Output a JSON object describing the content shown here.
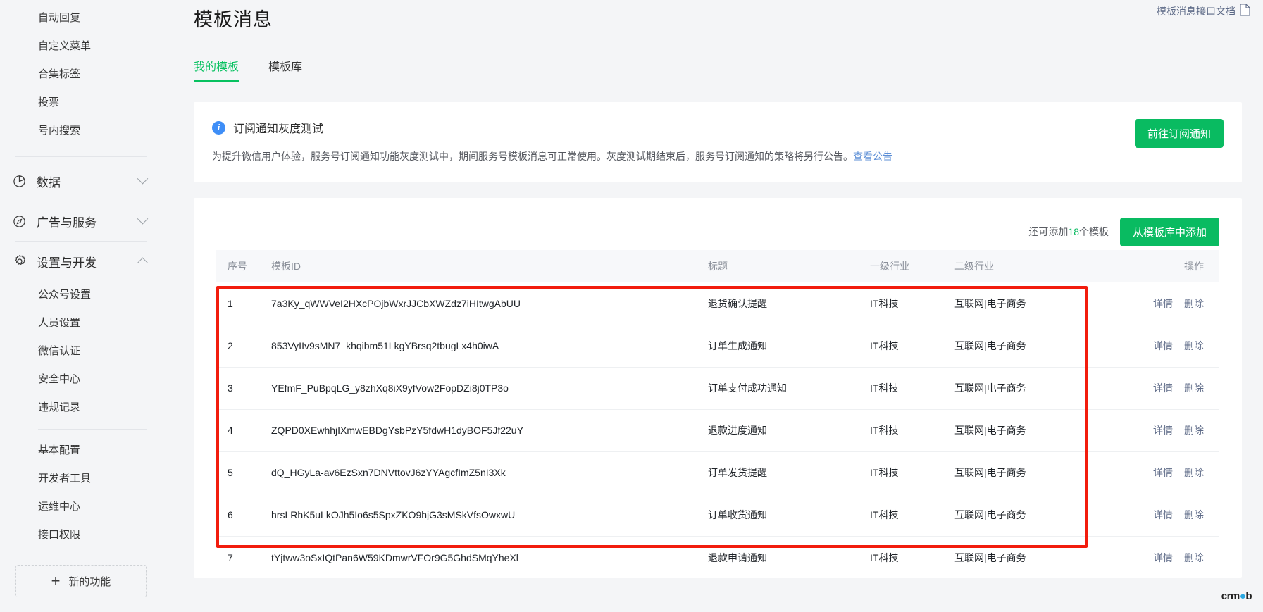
{
  "sidebar": {
    "top_items": [
      {
        "label": "自动回复"
      },
      {
        "label": "自定义菜单"
      },
      {
        "label": "合集标签"
      },
      {
        "label": "投票"
      },
      {
        "label": "号内搜索"
      }
    ],
    "groups": [
      {
        "label": "数据",
        "icon": "pie-chart-icon",
        "expanded": false
      },
      {
        "label": "广告与服务",
        "icon": "compass-icon",
        "expanded": false
      },
      {
        "label": "设置与开发",
        "icon": "gear-icon",
        "expanded": true
      }
    ],
    "settings_items_a": [
      {
        "label": "公众号设置"
      },
      {
        "label": "人员设置"
      },
      {
        "label": "微信认证"
      },
      {
        "label": "安全中心"
      },
      {
        "label": "违规记录"
      }
    ],
    "settings_items_b": [
      {
        "label": "基本配置"
      },
      {
        "label": "开发者工具"
      },
      {
        "label": "运维中心"
      },
      {
        "label": "接口权限"
      }
    ],
    "new_feature": "新的功能"
  },
  "header": {
    "title": "模板消息",
    "doc_link": "模板消息接口文档",
    "doc_icon": "document-icon"
  },
  "tabs": [
    {
      "label": "我的模板",
      "active": true
    },
    {
      "label": "模板库",
      "active": false
    }
  ],
  "notice": {
    "icon": "info-icon",
    "title": "订阅通知灰度测试",
    "body": "为提升微信用户体验，服务号订阅通知功能灰度测试中，期间服务号模板消息可正常使用。灰度测试期结束后，服务号订阅通知的策略将另行公告。",
    "body_link": "查看公告",
    "button": "前往订阅通知"
  },
  "toolbar": {
    "quota_prefix": "还可添加",
    "quota_count": "18",
    "quota_suffix": "个模板",
    "add_button": "从模板库中添加"
  },
  "table": {
    "columns": [
      "序号",
      "模板ID",
      "标题",
      "一级行业",
      "二级行业",
      "操作"
    ],
    "actions": {
      "detail": "详情",
      "delete": "删除"
    },
    "rows": [
      {
        "no": "1",
        "id": "7a3Ky_qWWVeI2HXcPOjbWxrJJCbXWZdz7iHItwgAbUU",
        "title": "退货确认提醒",
        "industry1": "IT科技",
        "industry2": "互联网|电子商务"
      },
      {
        "no": "2",
        "id": "853VyIIv9sMN7_khqibm51LkgYBrsq2tbugLx4h0iwA",
        "title": "订单生成通知",
        "industry1": "IT科技",
        "industry2": "互联网|电子商务"
      },
      {
        "no": "3",
        "id": "YEfmF_PuBpqLG_y8zhXq8iX9yfVow2FopDZi8j0TP3o",
        "title": "订单支付成功通知",
        "industry1": "IT科技",
        "industry2": "互联网|电子商务"
      },
      {
        "no": "4",
        "id": "ZQPD0XEwhhjIXmwEBDgYsbPzY5fdwH1dyBOF5Jf22uY",
        "title": "退款进度通知",
        "industry1": "IT科技",
        "industry2": "互联网|电子商务"
      },
      {
        "no": "5",
        "id": "dQ_HGyLa-av6EzSxn7DNVttovJ6zYYAgcfImZ5nI3Xk",
        "title": "订单发货提醒",
        "industry1": "IT科技",
        "industry2": "互联网|电子商务"
      },
      {
        "no": "6",
        "id": "hrsLRhK5uLkOJh5Io6s5SpxZKO9hjG3sMSkVfsOwxwU",
        "title": "订单收货通知",
        "industry1": "IT科技",
        "industry2": "互联网|电子商务"
      },
      {
        "no": "7",
        "id": "tYjtww3oSxIQtPan6W59KDmwrVFOr9G5GhdSMqYheXl",
        "title": "退款申请通知",
        "industry1": "IT科技",
        "industry2": "互联网|电子商务"
      }
    ]
  },
  "watermark": {
    "text_a": "crm",
    "text_b": "b"
  },
  "colors": {
    "accent_green": "#09bb61",
    "info_blue": "#3e8ef7",
    "link_blue": "#5d6a87",
    "highlight_red": "#f21c0d",
    "page_bg": "#f4f5f7"
  }
}
